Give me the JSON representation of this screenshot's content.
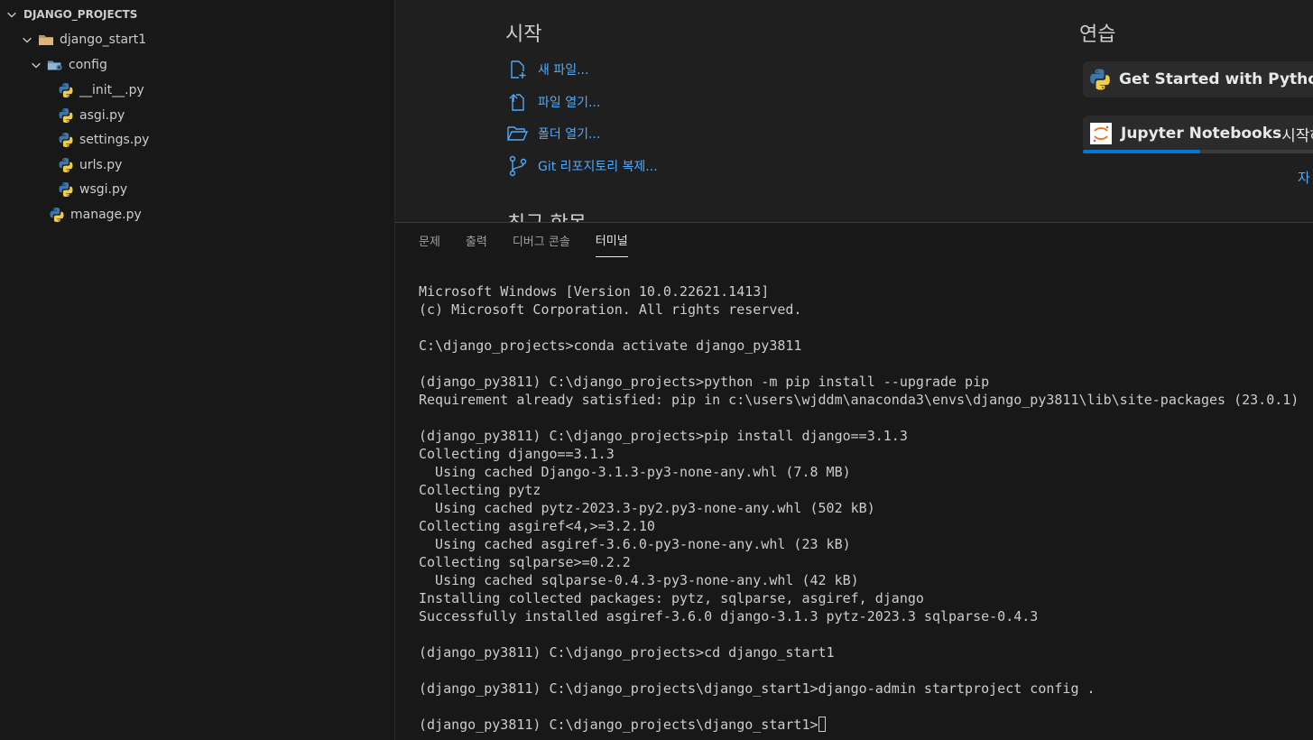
{
  "explorer": {
    "header": "DJANGO_PROJECTS",
    "tree": [
      {
        "label": "django_start1",
        "icon": "folder-icon"
      },
      {
        "label": "config",
        "icon": "config-folder-icon"
      },
      {
        "label": "__init__.py",
        "icon": "python-icon"
      },
      {
        "label": "asgi.py",
        "icon": "python-icon"
      },
      {
        "label": "settings.py",
        "icon": "python-icon"
      },
      {
        "label": "urls.py",
        "icon": "python-icon"
      },
      {
        "label": "wsgi.py",
        "icon": "python-icon"
      },
      {
        "label": "manage.py",
        "icon": "python-icon"
      }
    ]
  },
  "welcome": {
    "start_title": "시작",
    "start_items": [
      {
        "label": "새 파일...",
        "icon": "new-file-icon"
      },
      {
        "label": "파일 열기...",
        "icon": "open-file-icon"
      },
      {
        "label": "폴더 열기...",
        "icon": "open-folder-icon"
      },
      {
        "label": "Git 리포지토리 복제...",
        "icon": "git-clone-icon"
      }
    ],
    "walkthrough_title": "연습",
    "walkthroughs": [
      {
        "label": "Get Started with Python De",
        "rest": "",
        "icon": "python-icon"
      },
      {
        "label": "Jupyter Notebooks",
        "rest": " 시작하",
        "icon": "jupyter-icon"
      }
    ],
    "progress": 0.5,
    "more_label": "자",
    "recent_title": "최근 항목"
  },
  "panel": {
    "tabs": [
      "문제",
      "출력",
      "디버그 콘솔",
      "터미널"
    ],
    "active_tab": 3,
    "terminal_lines": [
      "Microsoft Windows [Version 10.0.22621.1413]",
      "(c) Microsoft Corporation. All rights reserved.",
      "",
      "C:\\django_projects>conda activate django_py3811",
      "",
      "(django_py3811) C:\\django_projects>python -m pip install --upgrade pip",
      "Requirement already satisfied: pip in c:\\users\\wjddm\\anaconda3\\envs\\django_py3811\\lib\\site-packages (23.0.1)",
      "",
      "(django_py3811) C:\\django_projects>pip install django==3.1.3",
      "Collecting django==3.1.3",
      "  Using cached Django-3.1.3-py3-none-any.whl (7.8 MB)",
      "Collecting pytz",
      "  Using cached pytz-2023.3-py2.py3-none-any.whl (502 kB)",
      "Collecting asgiref<4,>=3.2.10",
      "  Using cached asgiref-3.6.0-py3-none-any.whl (23 kB)",
      "Collecting sqlparse>=0.2.2",
      "  Using cached sqlparse-0.4.3-py3-none-any.whl (42 kB)",
      "Installing collected packages: pytz, sqlparse, asgiref, django",
      "Successfully installed asgiref-3.6.0 django-3.1.3 pytz-2023.3 sqlparse-0.4.3",
      "",
      "(django_py3811) C:\\django_projects>cd django_start1",
      "",
      "(django_py3811) C:\\django_projects\\django_start1>django-admin startproject config .",
      "",
      "(django_py3811) C:\\django_projects\\django_start1>"
    ]
  },
  "colors": {
    "accent": "#0078d4",
    "link": "#4daafc",
    "background": "#1f1f1f",
    "sidebar": "#181818"
  }
}
